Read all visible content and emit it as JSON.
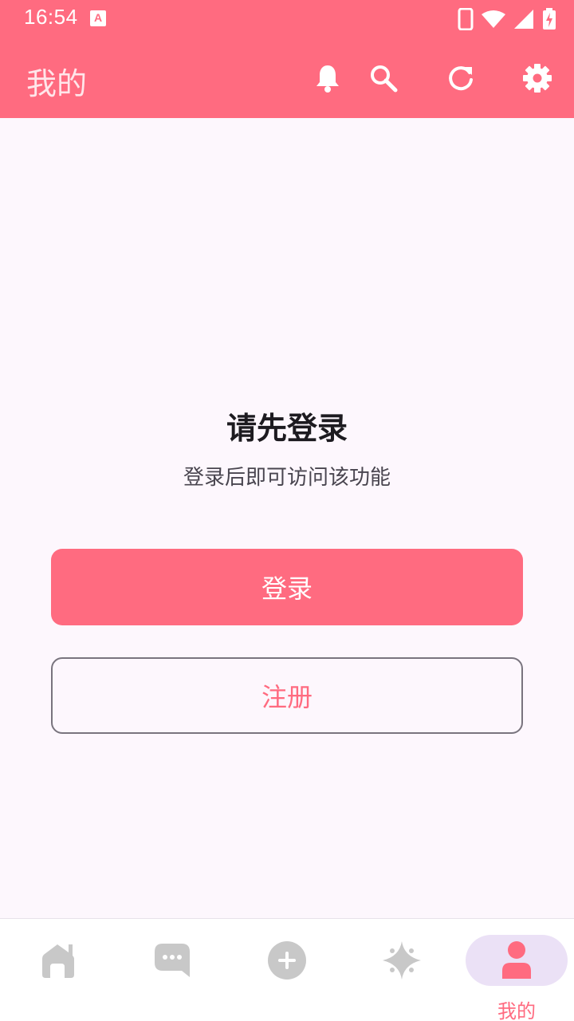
{
  "status_bar": {
    "time": "16:54",
    "a_label": "A"
  },
  "app_bar": {
    "title": "我的",
    "actions": [
      {
        "icon": "bell-icon"
      },
      {
        "icon": "search-icon"
      },
      {
        "icon": "refresh-icon"
      },
      {
        "icon": "gear-icon"
      }
    ]
  },
  "content": {
    "heading": "请先登录",
    "subheading": "登录后即可访问该功能",
    "login_label": "登录",
    "register_label": "注册"
  },
  "bottom_nav": {
    "items": [
      {
        "icon": "home-icon",
        "label": "",
        "active": false
      },
      {
        "icon": "chat-icon",
        "label": "",
        "active": false
      },
      {
        "icon": "add-circle-icon",
        "label": "",
        "active": false
      },
      {
        "icon": "sparkle-icon",
        "label": "",
        "active": false
      },
      {
        "icon": "person-icon",
        "label": "我的",
        "active": true
      }
    ]
  },
  "colors": {
    "primary": "#ff6b80",
    "background": "#fdf7fd",
    "nav_active_pill": "#ebe1f6",
    "nav_inactive_icon": "#c8c8c8"
  }
}
